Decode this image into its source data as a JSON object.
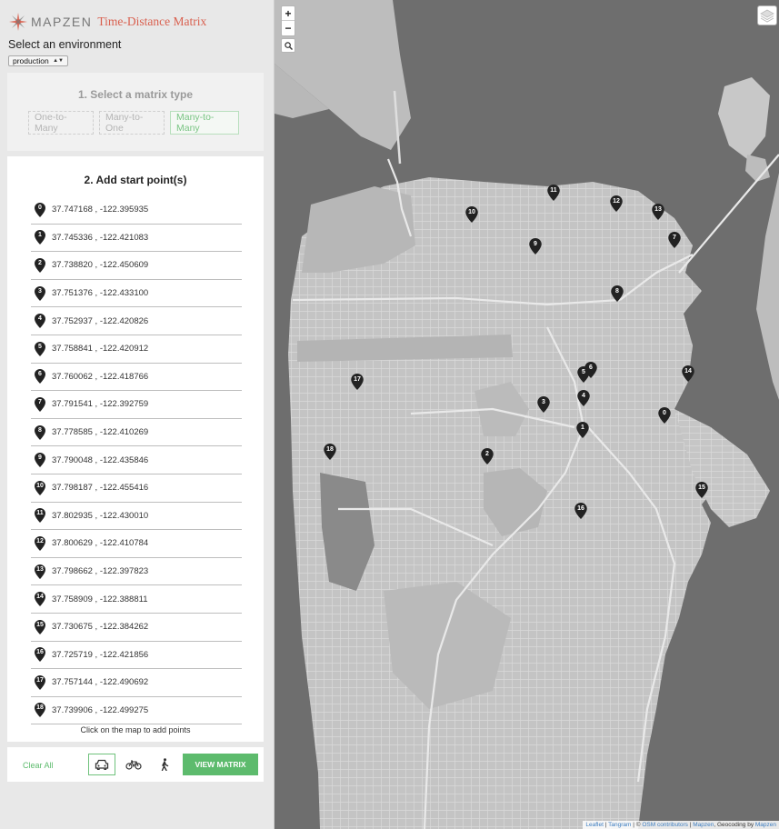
{
  "brand": {
    "name": "MAPZEN",
    "app_title": "Time-Distance Matrix"
  },
  "environment": {
    "label": "Select an environment",
    "selected": "production"
  },
  "matrix_type": {
    "title": "1. Select a matrix type",
    "options": [
      "One-to-Many",
      "Many-to-One",
      "Many-to-Many"
    ],
    "selected": "Many-to-Many"
  },
  "points": {
    "title": "2. Add start point(s)",
    "items": [
      {
        "id": "0",
        "coord": "37.747168 , -122.395935"
      },
      {
        "id": "1",
        "coord": "37.745336 , -122.421083"
      },
      {
        "id": "2",
        "coord": "37.738820 , -122.450609"
      },
      {
        "id": "3",
        "coord": "37.751376 , -122.433100"
      },
      {
        "id": "4",
        "coord": "37.752937 , -122.420826"
      },
      {
        "id": "5",
        "coord": "37.758841 , -122.420912"
      },
      {
        "id": "6",
        "coord": "37.760062 , -122.418766"
      },
      {
        "id": "7",
        "coord": "37.791541 , -122.392759"
      },
      {
        "id": "8",
        "coord": "37.778585 , -122.410269"
      },
      {
        "id": "9",
        "coord": "37.790048 , -122.435846"
      },
      {
        "id": "10",
        "coord": "37.798187 , -122.455416"
      },
      {
        "id": "11",
        "coord": "37.802935 , -122.430010"
      },
      {
        "id": "12",
        "coord": "37.800629 , -122.410784"
      },
      {
        "id": "13",
        "coord": "37.798662 , -122.397823"
      },
      {
        "id": "14",
        "coord": "37.758909 , -122.388811"
      },
      {
        "id": "15",
        "coord": "37.730675 , -122.384262"
      },
      {
        "id": "16",
        "coord": "37.725719 , -122.421856"
      },
      {
        "id": "17",
        "coord": "37.757144 , -122.490692"
      },
      {
        "id": "18",
        "coord": "37.739906 , -122.499275"
      }
    ],
    "hint": "Click on the map to add points"
  },
  "footer": {
    "clear_label": "Clear All",
    "modes": [
      "car-icon",
      "bicycle-icon",
      "pedestrian-icon"
    ],
    "active_mode": "car-icon",
    "view_label": "VIEW MATRIX"
  },
  "map": {
    "zoom_in": "+",
    "zoom_out": "−",
    "attribution": {
      "leaflet": "Leaflet",
      "sep1": " | ",
      "tangram": "Tangram",
      "sep2": " | © ",
      "osm": "OSM contributors",
      "sep3": " | ",
      "mapzen": "Mapzen",
      "sep4": ", Geocoding by ",
      "mapzen2": "Mapzen"
    }
  },
  "colors": {
    "accent_green": "#5dbb6d",
    "brand_red": "#d9604f",
    "marker": "#222222",
    "water": "#6e6e6e",
    "land": "#c9c9c9"
  }
}
